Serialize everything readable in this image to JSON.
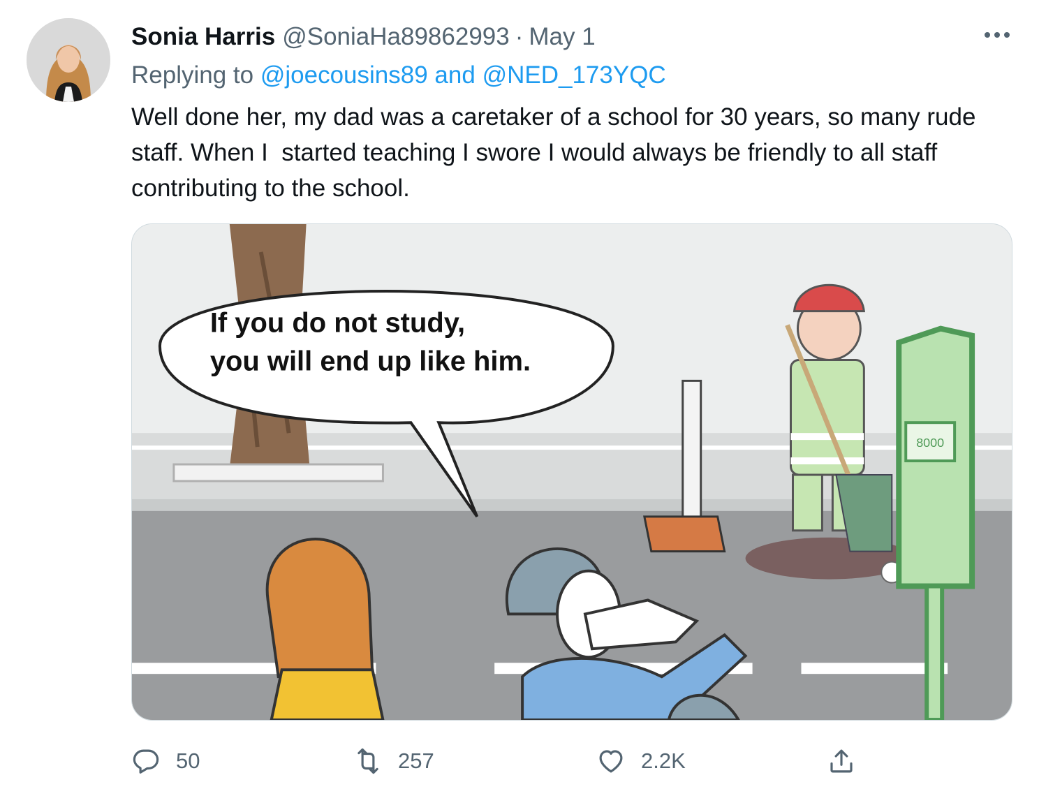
{
  "tweet": {
    "author_name": "Sonia Harris",
    "author_handle": "@SoniaHa89862993",
    "separator": "·",
    "date": "May 1",
    "reply_prefix": "Replying to",
    "reply_mention_1": "@joecousins89",
    "reply_and": "and",
    "reply_mention_2": "@NED_173YQC",
    "text": "Well done her, my dad was a caretaker of a school for 30 years, so many rude staff. When I  started teaching I swore I would always be friendly to all staff contributing to the school."
  },
  "media": {
    "speech_line_1": "If you do not study,",
    "speech_line_2": "you will end up like him.",
    "sign_text": "8000"
  },
  "actions": {
    "replies": "50",
    "retweets": "257",
    "likes": "2.2K"
  },
  "icons": {
    "more": "more-dots-icon",
    "reply": "reply-bubble-icon",
    "retweet": "retweet-icon",
    "like": "heart-icon",
    "share": "share-icon"
  },
  "colors": {
    "link": "#1d9bf0",
    "secondary_text": "#536471",
    "primary_text": "#0f1419"
  }
}
